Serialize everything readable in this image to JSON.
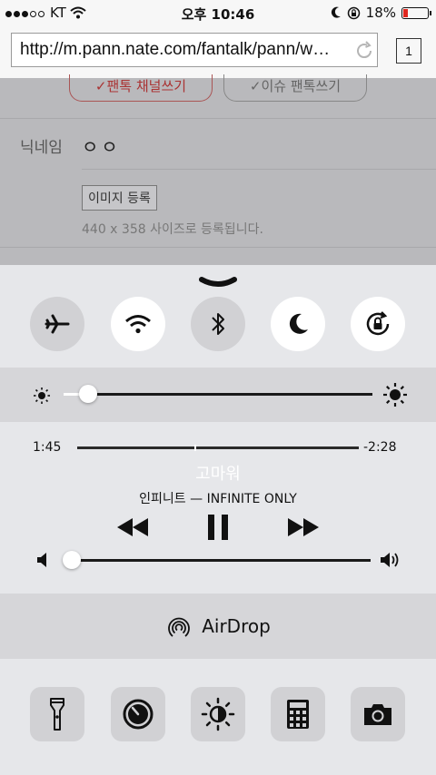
{
  "status_bar": {
    "carrier": "KT",
    "time": "오후 10:46",
    "battery": "18%",
    "battery_level": 0.18
  },
  "browser": {
    "url": "http://m.pann.nate.com/fantalk/pann/w…",
    "tab_count": "1"
  },
  "webpage": {
    "button_channel": "✓팬톡 채널쓰기",
    "button_issue": "✓이슈 팬톡쓰기",
    "nickname_label": "닉네임",
    "nickname_value": "ㅇㅇ",
    "image_button": "이미지 등록",
    "image_note": "440 x 358 사이즈로 등록됩니다."
  },
  "control_center": {
    "toggles": [
      {
        "name": "airplane-mode",
        "state": "off"
      },
      {
        "name": "wifi",
        "state": "on"
      },
      {
        "name": "bluetooth",
        "state": "off"
      },
      {
        "name": "do-not-disturb",
        "state": "on"
      },
      {
        "name": "rotation-lock",
        "state": "on"
      }
    ],
    "brightness_level": 0.08,
    "music": {
      "elapsed": "1:45",
      "remaining": "-2:28",
      "progress": 0.42,
      "title": "고마워",
      "artist_album": "인피니트 — INFINITE ONLY"
    },
    "volume_level": 0.02,
    "airdrop_label": "AirDrop",
    "shortcuts": [
      "flashlight",
      "timer",
      "night-shift",
      "calculator",
      "camera"
    ]
  }
}
